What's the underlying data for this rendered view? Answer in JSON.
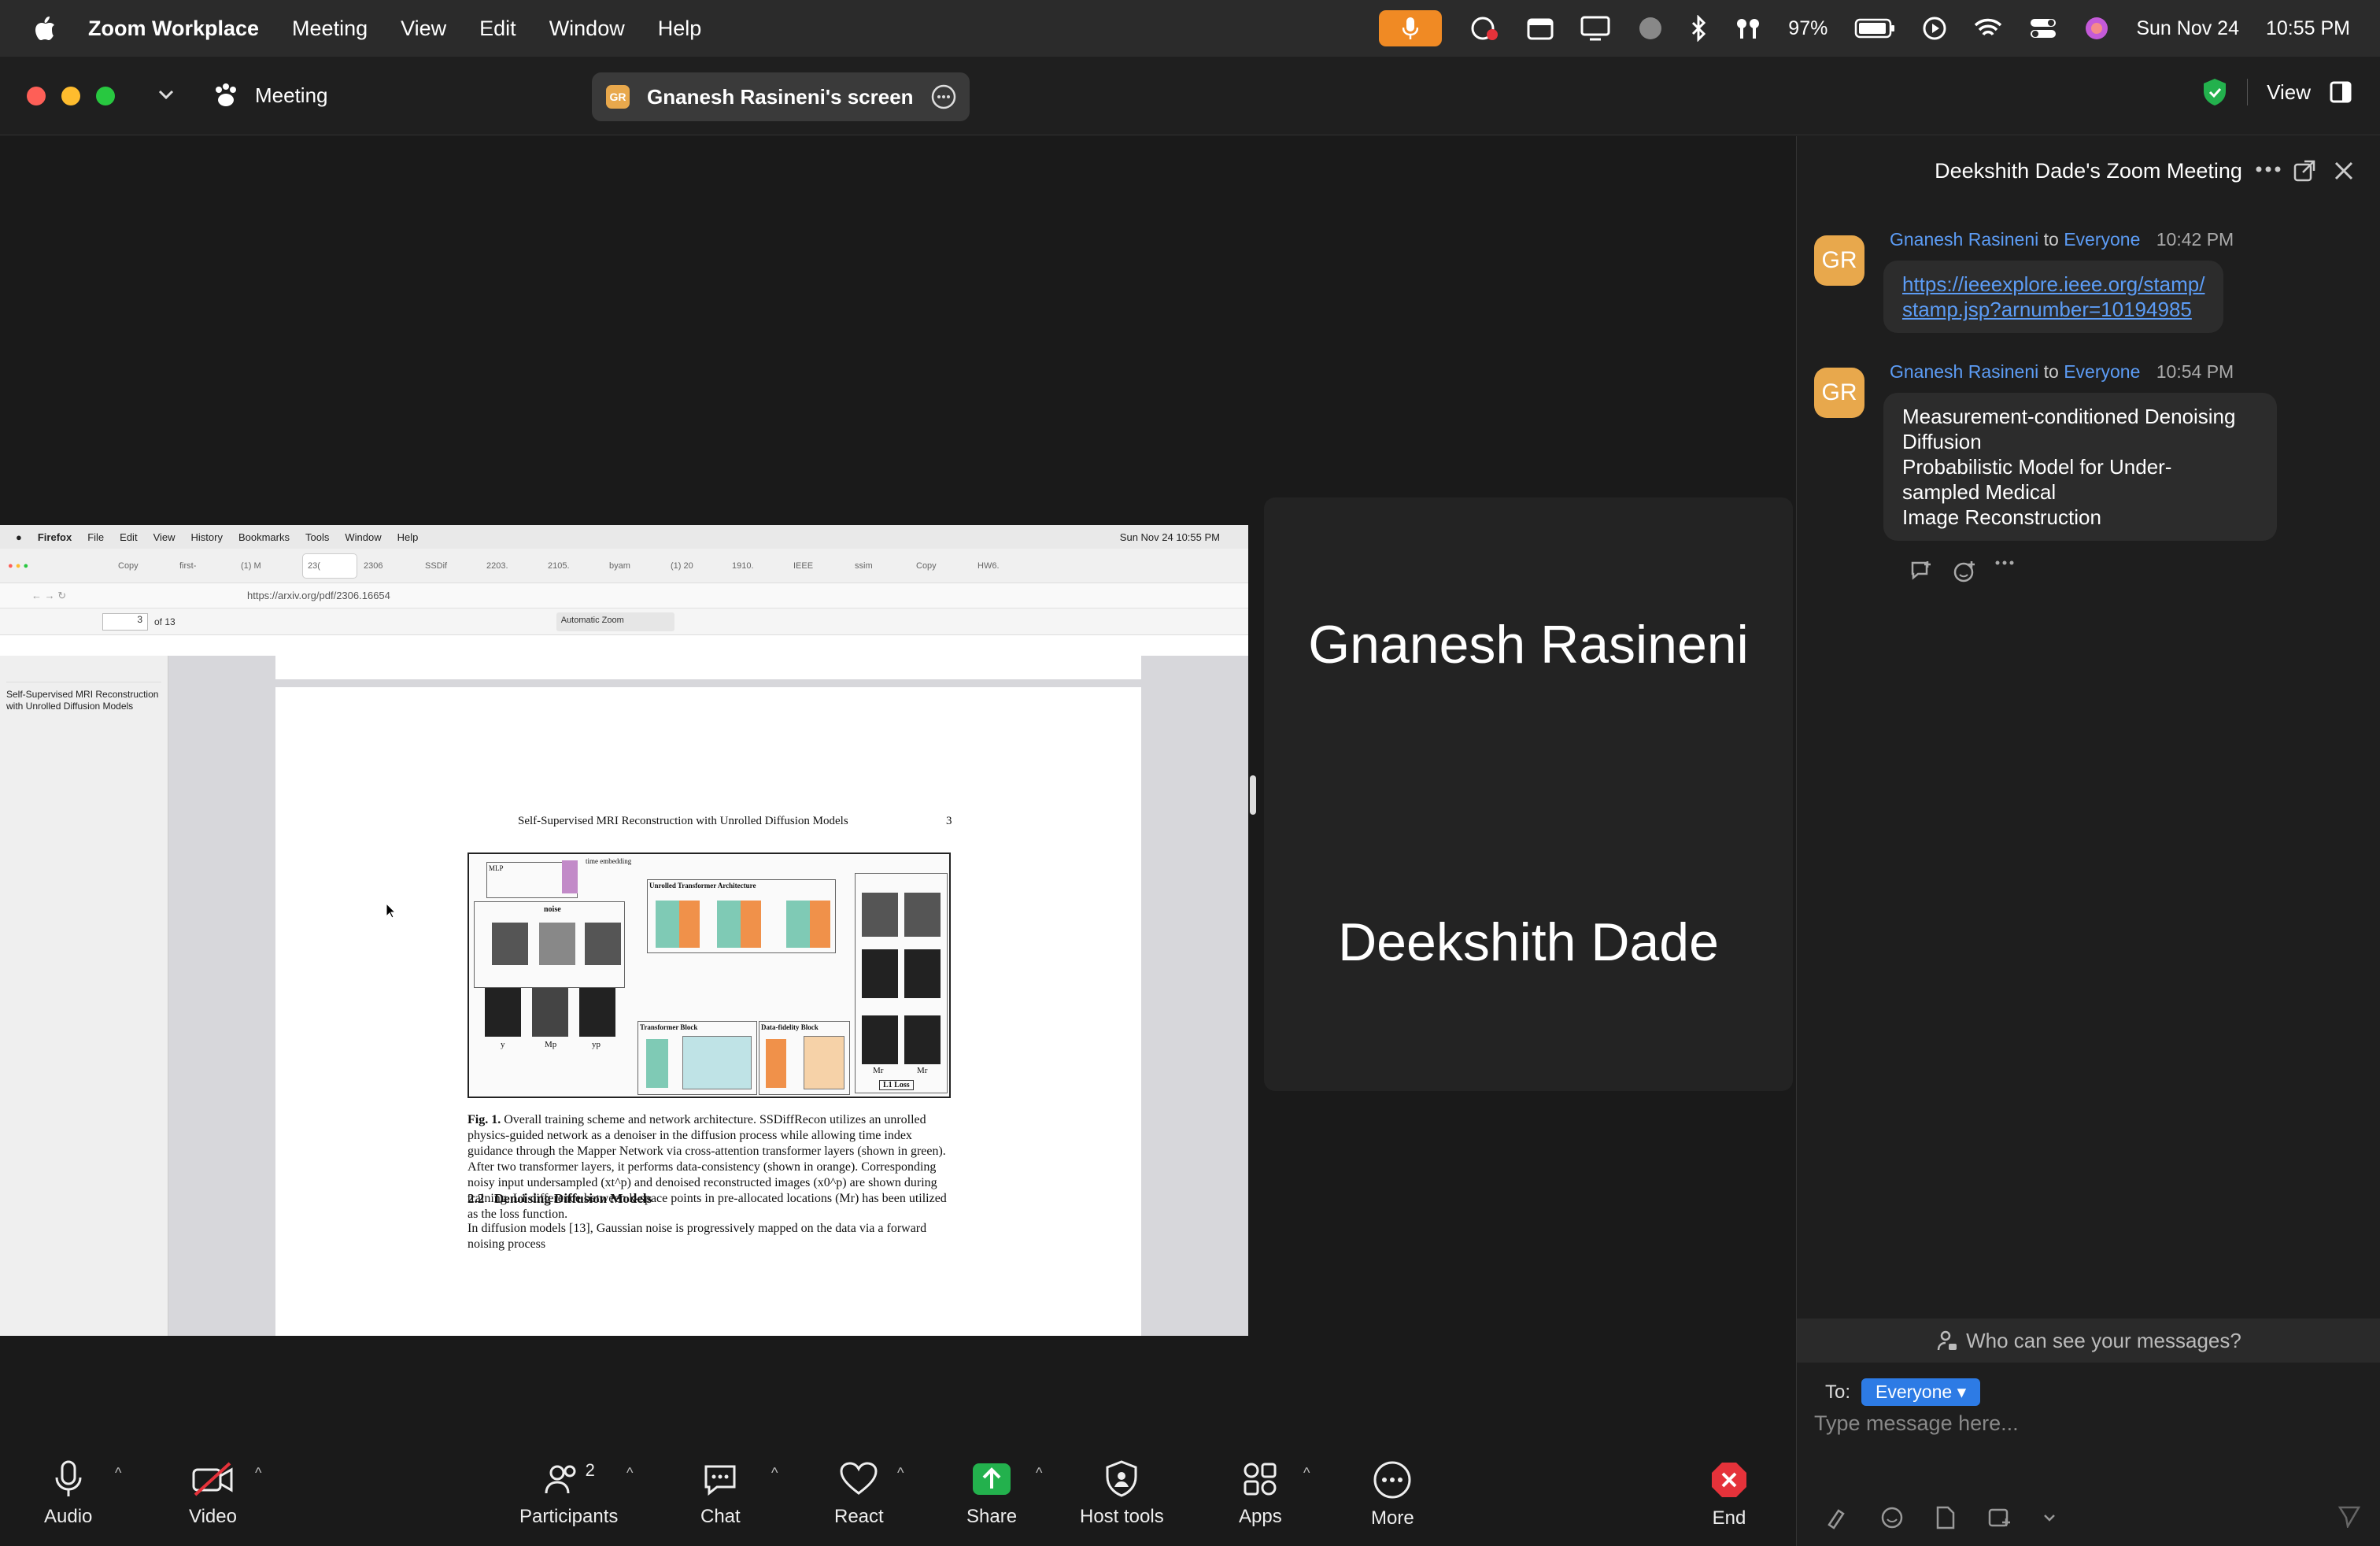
{
  "menubar": {
    "app_name": "Zoom Workplace",
    "items": [
      "Meeting",
      "View",
      "Edit",
      "Window",
      "Help"
    ],
    "battery": "97%",
    "date": "Sun Nov 24",
    "time": "10:55 PM"
  },
  "titlebar": {
    "meeting_label": "Meeting",
    "share_avatar": "GR",
    "share_title": "Gnanesh Rasineni's screen",
    "view_label": "View"
  },
  "shared_screen": {
    "ff_menu": [
      "Firefox",
      "File",
      "Edit",
      "View",
      "History",
      "Bookmarks",
      "Tools",
      "Window",
      "Help"
    ],
    "ff_datetime": "Sun Nov 24  10:55 PM",
    "tabs": [
      "Copy",
      "first-",
      "(1) M",
      "23(",
      "2306",
      "SSDif",
      "2203.",
      "2105.",
      "byam",
      "(1) 20",
      "1910.",
      "IEEE",
      "ssim",
      "Copy",
      "HW6."
    ],
    "url": "https://arxiv.org/pdf/2306.16654",
    "page_num": "3",
    "page_of": "of 13",
    "zoom": "Automatic Zoom",
    "outline_item": "Self-Supervised MRI Reconstruction with Unrolled Diffusion Models",
    "running_head": "Self-Supervised MRI Reconstruction with Unrolled Diffusion Models",
    "page_number": "3",
    "fig_labels": {
      "mlp": "MLP",
      "time_emb": "time embedding",
      "unrolled": "Unrolled Transformer Architecture",
      "transformer_block": "Transformer Block",
      "data_fidelity": "Data-fidelity Block",
      "l1": "L1 Loss",
      "noise": "noise",
      "y": "y",
      "mp": "Mp",
      "yp": "yp",
      "mr1": "Mr",
      "mr2": "Mr"
    },
    "caption_bold": "Fig. 1.",
    "caption": "Overall training scheme and network architecture. SSDiffRecon utilizes an unrolled physics-guided network as a denoiser in the diffusion process while allowing time index guidance through the Mapper Network via cross-attention transformer layers (shown in green). After two transformer layers, it performs data-consistency (shown in orange). Corresponding noisy input undersampled (xt^p) and denoised reconstructed images (x0^p) are shown during training. L1 difference between k-space points in pre-allocated locations (Mr) has been utilized as the loss function.",
    "section_num": "2.2",
    "section_title": "Denoising Diffusion Models",
    "body": "In diffusion models [13], Gaussian noise is progressively mapped on the data via a forward noising process"
  },
  "participants_tile": {
    "name1": "Gnanesh Rasineni",
    "name2": "Deekshith Dade"
  },
  "chat": {
    "title": "Deekshith Dade's Zoom Meeting",
    "messages": [
      {
        "avatar": "GR",
        "sender": "Gnanesh Rasineni",
        "to_word": "to",
        "recipient": "Everyone",
        "time": "10:42 PM",
        "line1": "https://ieeexplore.ieee.org/stamp/",
        "line2": "stamp.jsp?arnumber=10194985"
      },
      {
        "avatar": "GR",
        "sender": "Gnanesh Rasineni",
        "to_word": "to",
        "recipient": "Everyone",
        "time": "10:54 PM",
        "lines": [
          "Measurement-conditioned Denoising",
          "Diffusion",
          "Probabilistic Model for Under-",
          "sampled Medical",
          "Image Reconstruction"
        ]
      }
    ],
    "who_can_see": "Who can see your messages?",
    "to_label": "To:",
    "to_value": "Everyone",
    "placeholder": "Type message here..."
  },
  "toolbar": {
    "audio": "Audio",
    "video": "Video",
    "participants": "Participants",
    "participants_count": "2",
    "chat": "Chat",
    "react": "React",
    "share": "Share",
    "host_tools": "Host tools",
    "apps": "Apps",
    "more": "More",
    "end": "End"
  },
  "colors": {
    "accent_blue": "#2d7be5",
    "link_blue": "#5c9cf5",
    "mic_orange": "#f08a24",
    "share_green": "#23b14d",
    "end_red": "#e5323a",
    "avatar_gold": "#e8a84c"
  }
}
